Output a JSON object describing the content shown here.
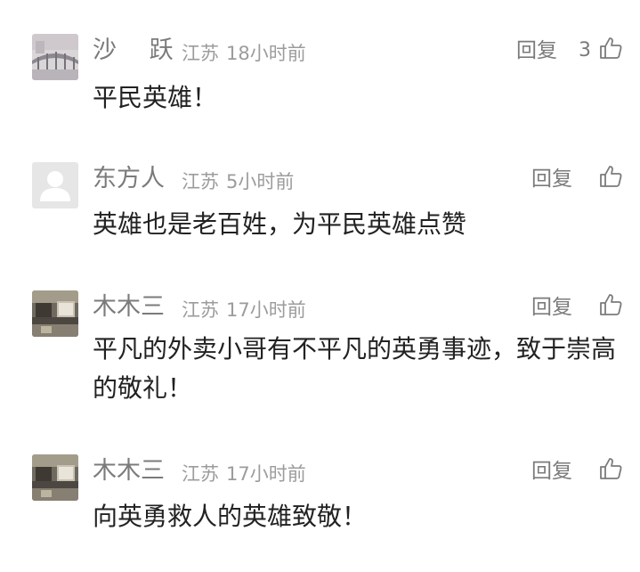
{
  "comments": [
    {
      "name": "沙 跃",
      "location": "江苏",
      "time": "18小时前",
      "reply_label": "回复",
      "like_count": "3",
      "text": "平民英雄！",
      "avatar": "bridge-photo"
    },
    {
      "name": "东方人",
      "location": "江苏",
      "time": "5小时前",
      "reply_label": "回复",
      "like_count": "",
      "text": "英雄也是老百姓，为平民英雄点赞",
      "avatar": "default-user"
    },
    {
      "name": "木木三",
      "location": "江苏",
      "time": "17小时前",
      "reply_label": "回复",
      "like_count": "",
      "text": "平凡的外卖小哥有不平凡的英勇事迹，致于崇高的敬礼！",
      "avatar": "room-photo"
    },
    {
      "name": "木木三",
      "location": "江苏",
      "time": "17小时前",
      "reply_label": "回复",
      "like_count": "",
      "text": "向英勇救人的英雄致敬！",
      "avatar": "room-photo"
    }
  ],
  "colors": {
    "name": "#7b7b7b",
    "meta": "#9c9c9c",
    "body": "#222222",
    "background": "#ffffff"
  }
}
